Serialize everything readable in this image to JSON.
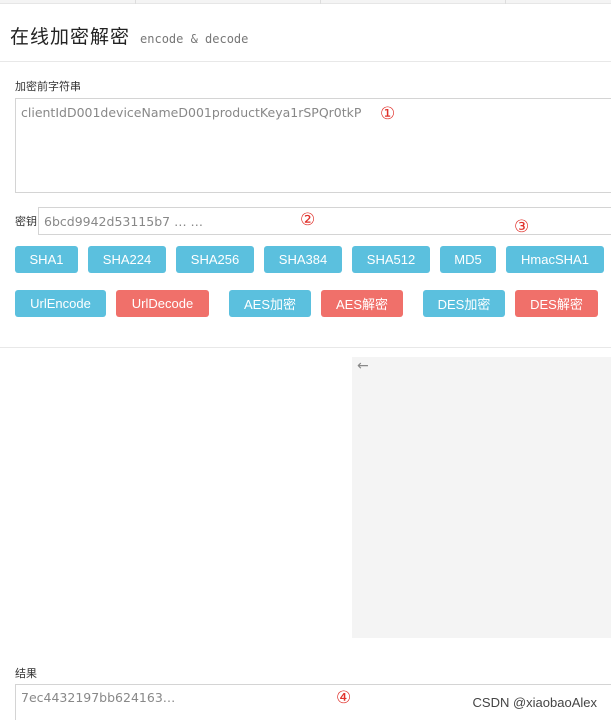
{
  "header": {
    "title": "在线加密解密",
    "subtitle": "encode & decode"
  },
  "input": {
    "label": "加密前字符串",
    "value": "clientIdD001deviceNameD001productKeya1rSPQr0tkP",
    "marker": "①"
  },
  "key": {
    "label": "密钥",
    "value": "6bcd9942d53115b7 … …",
    "marker": "②"
  },
  "hash_marker": "③",
  "hash_buttons": [
    "SHA1",
    "SHA224",
    "SHA256",
    "SHA384",
    "SHA512",
    "MD5",
    "HmacSHA1"
  ],
  "codec_buttons": [
    "UrlEncode",
    "UrlDecode",
    "AES加密",
    "AES解密",
    "DES加密",
    "DES解密"
  ],
  "panel": {
    "back_icon": "←"
  },
  "result": {
    "label": "结果",
    "value": "7ec4432197bb624163…",
    "marker": "④"
  },
  "watermark": "CSDN @xiaobaoAlex",
  "colors": {
    "encode_button": "#5bc0de",
    "decode_button": "#f0706a",
    "marker": "#e0312b"
  }
}
